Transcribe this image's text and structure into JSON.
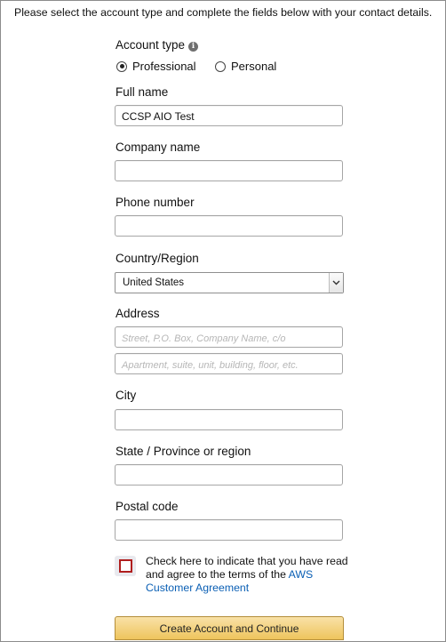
{
  "intro_text": "Please select the account type and complete the fields below with your contact details.",
  "account_type": {
    "label": "Account type",
    "info_icon": "info-icon",
    "options": [
      {
        "label": "Professional",
        "selected": true
      },
      {
        "label": "Personal",
        "selected": false
      }
    ]
  },
  "fields": {
    "full_name": {
      "label": "Full name",
      "value": "CCSP AIO Test"
    },
    "company_name": {
      "label": "Company name",
      "value": ""
    },
    "phone_number": {
      "label": "Phone number",
      "value": ""
    },
    "country": {
      "label": "Country/Region",
      "value": "United States"
    },
    "address": {
      "label": "Address",
      "line1_placeholder": "Street, P.O. Box, Company Name, c/o",
      "line2_placeholder": "Apartment, suite, unit, building, floor, etc."
    },
    "city": {
      "label": "City",
      "value": ""
    },
    "state": {
      "label": "State / Province or region",
      "value": ""
    },
    "postal_code": {
      "label": "Postal code",
      "value": ""
    }
  },
  "agreement": {
    "text": "Check here to indicate that you have read and agree to the terms of the ",
    "link": "AWS Customer Agreement",
    "checked": false,
    "border_color": "#b01e1e"
  },
  "submit_label": "Create Account and Continue",
  "colors": {
    "link": "#0a5fb4",
    "button": "#f0c14b"
  }
}
